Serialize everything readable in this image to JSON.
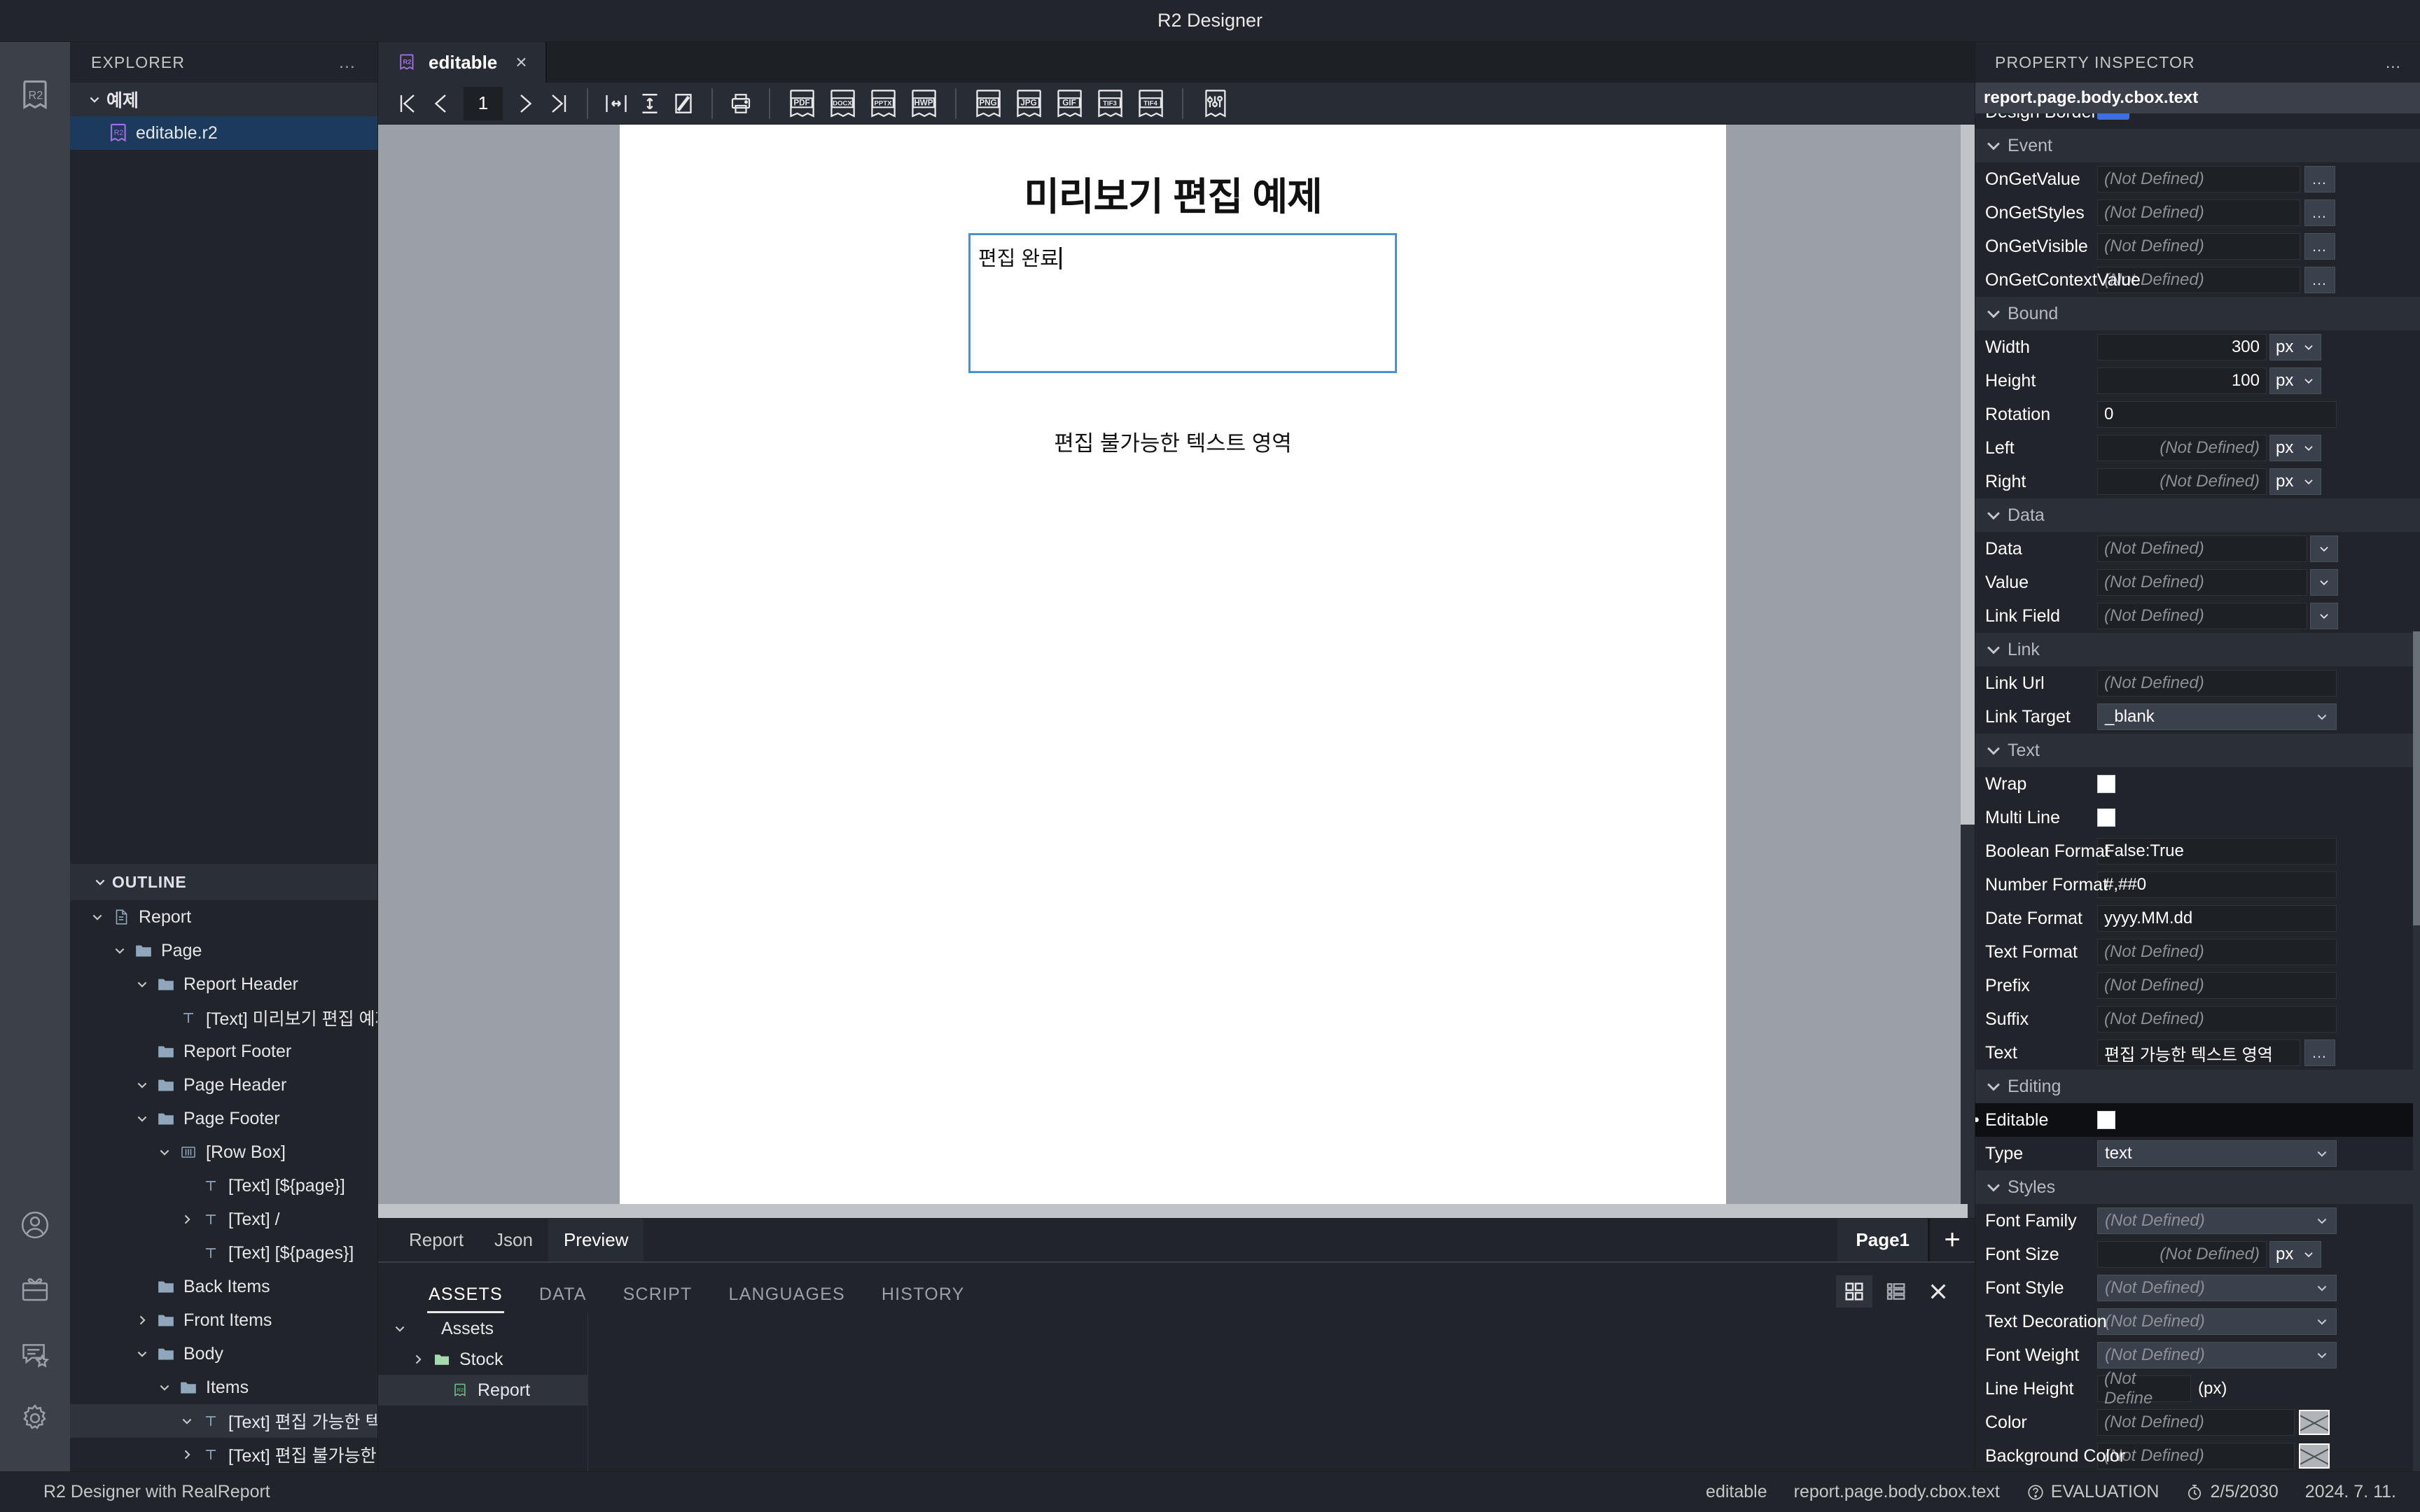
{
  "titlebar": {
    "title": "R2 Designer"
  },
  "activitybar": {
    "logo_icon": "r2-logo-icon",
    "items": [
      {
        "icon": "account-icon"
      },
      {
        "icon": "gift-icon"
      },
      {
        "icon": "feedback-icon"
      },
      {
        "icon": "settings-gear-icon"
      }
    ]
  },
  "explorer": {
    "title": "EXPLORER",
    "more": "…",
    "root": {
      "label": "예제",
      "expanded": true
    },
    "files": [
      {
        "label": "editable.r2",
        "selected": true
      }
    ]
  },
  "outline": {
    "title": "OUTLINE",
    "items": [
      {
        "label": "Report",
        "indent": 0,
        "chevron": "down",
        "icon": "file-icon"
      },
      {
        "label": "Page",
        "indent": 1,
        "chevron": "down",
        "icon": "folder-icon"
      },
      {
        "label": "Report Header",
        "indent": 2,
        "chevron": "down",
        "icon": "folder-icon"
      },
      {
        "label": "[Text] 미리보기 편집 예제",
        "indent": 3,
        "chevron": "none",
        "icon": "text-icon"
      },
      {
        "label": "Report Footer",
        "indent": 2,
        "chevron": "none",
        "icon": "folder-icon"
      },
      {
        "label": "Page Header",
        "indent": 2,
        "chevron": "down",
        "icon": "folder-icon"
      },
      {
        "label": "Page Footer",
        "indent": 2,
        "chevron": "down",
        "icon": "folder-icon"
      },
      {
        "label": "[Row Box]",
        "indent": 3,
        "chevron": "down",
        "icon": "rowbox-icon"
      },
      {
        "label": "[Text] [${page}]",
        "indent": 4,
        "chevron": "none",
        "icon": "text-icon"
      },
      {
        "label": "[Text] /",
        "indent": 4,
        "chevron": "right",
        "icon": "text-icon"
      },
      {
        "label": "[Text] [${pages}]",
        "indent": 4,
        "chevron": "none",
        "icon": "text-icon"
      },
      {
        "label": "Back Items",
        "indent": 2,
        "chevron": "none",
        "icon": "folder-icon"
      },
      {
        "label": "Front Items",
        "indent": 2,
        "chevron": "right",
        "icon": "folder-icon"
      },
      {
        "label": "Body",
        "indent": 2,
        "chevron": "down",
        "icon": "folder-icon"
      },
      {
        "label": "Items",
        "indent": 3,
        "chevron": "down",
        "icon": "folder-icon"
      },
      {
        "label": "[Text] 편집 가능한 텍스…",
        "indent": 4,
        "chevron": "down",
        "icon": "text-icon",
        "selected": true
      },
      {
        "label": "[Text] 편집 불가능한 텍…",
        "indent": 4,
        "chevron": "right",
        "icon": "text-icon"
      }
    ]
  },
  "editor": {
    "tab": {
      "label": "editable",
      "icon": "r2-file-icon",
      "close": "×"
    },
    "toolbar": {
      "nav": [
        {
          "name": "first-page",
          "icon": "first-page-icon"
        },
        {
          "name": "prev-page",
          "icon": "prev-page-icon"
        }
      ],
      "page_number": "1",
      "nav2": [
        {
          "name": "next-page",
          "icon": "next-page-icon"
        },
        {
          "name": "last-page",
          "icon": "last-page-icon"
        }
      ],
      "zoom": [
        {
          "name": "fit-width",
          "icon": "fit-width-icon"
        },
        {
          "name": "fit-height",
          "icon": "fit-height-icon"
        },
        {
          "name": "fit-page",
          "icon": "fit-page-icon"
        }
      ],
      "print": {
        "name": "print",
        "icon": "printer-icon"
      },
      "exports_doc": [
        "PDF",
        "DOCX",
        "PPTX",
        "HWP"
      ],
      "exports_img": [
        "PNG",
        "JPG",
        "GIF",
        "TIF3",
        "TIF4"
      ],
      "settings": {
        "name": "export-settings",
        "icon": "sliders-icon"
      }
    }
  },
  "document": {
    "title": "미리보기 편집 예제",
    "editable_box": {
      "value": "편집 완료",
      "placeholder": ""
    },
    "static_text": "편집 불가능한 텍스트 영역",
    "border_color": "#4c8fd6"
  },
  "viewbar": {
    "tabs": [
      {
        "label": "Report",
        "active": false
      },
      {
        "label": "Json",
        "active": false
      },
      {
        "label": "Preview",
        "active": true
      }
    ],
    "page_pill": "Page1",
    "add": "+"
  },
  "bottompanel": {
    "tabs": [
      {
        "label": "ASSETS",
        "active": true
      },
      {
        "label": "DATA",
        "active": false
      },
      {
        "label": "SCRIPT",
        "active": false
      },
      {
        "label": "LANGUAGES",
        "active": false
      },
      {
        "label": "HISTORY",
        "active": false
      }
    ],
    "tools": [
      {
        "name": "grid-view-icon",
        "active": true
      },
      {
        "name": "list-view-icon",
        "active": false
      },
      {
        "name": "close-icon",
        "active": false
      }
    ],
    "tree": [
      {
        "label": "Assets",
        "indent": 0,
        "chevron": "down",
        "icon": "none"
      },
      {
        "label": "Stock",
        "indent": 1,
        "chevron": "right",
        "icon": "folder-green-icon"
      },
      {
        "label": "Report",
        "indent": 2,
        "chevron": "none",
        "icon": "r2-green-icon",
        "selected": true
      }
    ]
  },
  "inspector": {
    "title": "PROPERTY INSPECTOR",
    "more": "…",
    "path": "report.page.body.cbox.text",
    "cut_row": {
      "label": "Design Border",
      "toggle_color": "#3d6fe0"
    },
    "groups": [
      {
        "name": "Event",
        "rows": [
          {
            "label": "OnGetValue",
            "kind": "text-ellipsis",
            "value": "(Not Defined)",
            "defined": false
          },
          {
            "label": "OnGetStyles",
            "kind": "text-ellipsis",
            "value": "(Not Defined)",
            "defined": false
          },
          {
            "label": "OnGetVisible",
            "kind": "text-ellipsis",
            "value": "(Not Defined)",
            "defined": false
          },
          {
            "label": "OnGetContextValue",
            "kind": "text-ellipsis",
            "value": "(Not Defined)",
            "defined": false
          }
        ]
      },
      {
        "name": "Bound",
        "rows": [
          {
            "label": "Width",
            "kind": "num-unit",
            "value": "300",
            "unit": "px",
            "defined": true
          },
          {
            "label": "Height",
            "kind": "num-unit",
            "value": "100",
            "unit": "px",
            "defined": true
          },
          {
            "label": "Rotation",
            "kind": "text-wide",
            "value": "0",
            "defined": true
          },
          {
            "label": "Left",
            "kind": "num-unit",
            "value": "(Not Defined)",
            "unit": "px",
            "defined": false
          },
          {
            "label": "Right",
            "kind": "num-unit",
            "value": "(Not Defined)",
            "unit": "px",
            "defined": false
          }
        ]
      },
      {
        "name": "Data",
        "rows": [
          {
            "label": "Data",
            "kind": "select",
            "value": "(Not Defined)",
            "defined": false
          },
          {
            "label": "Value",
            "kind": "select",
            "value": "(Not Defined)",
            "defined": false
          },
          {
            "label": "Link Field",
            "kind": "select",
            "value": "(Not Defined)",
            "defined": false
          }
        ]
      },
      {
        "name": "Link",
        "rows": [
          {
            "label": "Link Url",
            "kind": "text-wide",
            "value": "(Not Defined)",
            "defined": false
          },
          {
            "label": "Link Target",
            "kind": "select-filled",
            "value": "_blank",
            "defined": true
          }
        ]
      },
      {
        "name": "Text",
        "rows": [
          {
            "label": "Wrap",
            "kind": "checkbox",
            "checked": false
          },
          {
            "label": "Multi Line",
            "kind": "checkbox",
            "checked": false
          },
          {
            "label": "Boolean Format",
            "kind": "text-wide",
            "value": "False:True",
            "defined": true
          },
          {
            "label": "Number Format",
            "kind": "text-wide",
            "value": "#,##0",
            "defined": true
          },
          {
            "label": "Date Format",
            "kind": "text-wide",
            "value": "yyyy.MM.dd",
            "defined": true
          },
          {
            "label": "Text Format",
            "kind": "text-wide",
            "value": "(Not Defined)",
            "defined": false
          },
          {
            "label": "Prefix",
            "kind": "text-wide",
            "value": "(Not Defined)",
            "defined": false
          },
          {
            "label": "Suffix",
            "kind": "text-wide",
            "value": "(Not Defined)",
            "defined": false
          },
          {
            "label": "Text",
            "kind": "text-ellipsis",
            "value": "편집 가능한 텍스트 영역",
            "defined": true
          }
        ]
      },
      {
        "name": "Editing",
        "rows": [
          {
            "label": "Editable",
            "kind": "checkbox",
            "checked": false,
            "modified": true,
            "highlight": true
          },
          {
            "label": "Type",
            "kind": "select-filled",
            "value": "text",
            "defined": true
          }
        ]
      },
      {
        "name": "Styles",
        "rows": [
          {
            "label": "Font Family",
            "kind": "select-filled",
            "value": "(Not Defined)",
            "defined": false
          },
          {
            "label": "Font Size",
            "kind": "num-unit",
            "value": "(Not Defined)",
            "unit": "px",
            "defined": false
          },
          {
            "label": "Font Style",
            "kind": "select-filled",
            "value": "(Not Defined)",
            "defined": false
          },
          {
            "label": "Text Decoration",
            "kind": "select-filled",
            "value": "(Not Defined)",
            "defined": false
          },
          {
            "label": "Font Weight",
            "kind": "select-filled",
            "value": "(Not Defined)",
            "defined": false
          },
          {
            "label": "Line Height",
            "kind": "text-note",
            "value": "(Not Define",
            "note": "(px)",
            "defined": false
          },
          {
            "label": "Color",
            "kind": "color",
            "value": "(Not Defined)",
            "defined": false
          },
          {
            "label": "Background Color",
            "kind": "color",
            "value": "(Not Defined)",
            "defined": false
          }
        ]
      }
    ]
  },
  "statusbar": {
    "app": "R2 Designer with RealReport",
    "file": "editable",
    "path": "report.page.body.cbox.text",
    "license": "EVALUATION",
    "license_icon": "license-icon",
    "expiry": "2/5/2030",
    "expiry_icon": "clock-icon",
    "date": "2024. 7. 11."
  }
}
